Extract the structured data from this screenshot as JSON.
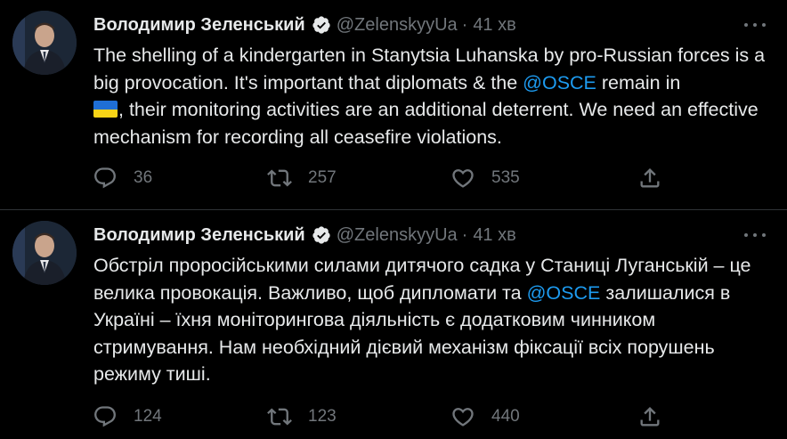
{
  "tweets": [
    {
      "author_name": "Володимир Зеленський",
      "handle": "@ZelenskyyUa",
      "separator": "·",
      "time": "41 хв",
      "text_1": "The shelling of a kindergarten in Stanytsia Luhanska by pro-Russian forces is a big provocation. It's important that diplomats & the ",
      "mention": "@OSCE",
      "text_2": " remain in ",
      "flag_icon": "ukraine-flag-emoji",
      "text_3": ", their monitoring activities are an additional deterrent. We need an effective mechanism for recording all ceasefire violations.",
      "replies": "36",
      "retweets": "257",
      "likes": "535"
    },
    {
      "author_name": "Володимир Зеленський",
      "handle": "@ZelenskyyUa",
      "separator": "·",
      "time": "41 хв",
      "text_1": "Обстріл проросійськими силами дитячого садка у Станиці Луганській – це велика провокація. Важливо, щоб дипломати та ",
      "mention": "@OSCE",
      "text_2": " залишалися в Україні – їхня моніторингова діяльність є додатковим чинником стримування. Нам необхідний дієвий механізм фіксації всіх порушень режиму тиші.",
      "replies": "124",
      "retweets": "123",
      "likes": "440"
    }
  ],
  "colors": {
    "background": "#000000",
    "text": "#e7e9ea",
    "secondary": "#71767b",
    "accent": "#1d9bf0",
    "divider": "#2f3336"
  },
  "icons": [
    "avatar",
    "verified-badge-icon",
    "more-icon",
    "reply-icon",
    "retweet-icon",
    "like-icon",
    "share-icon"
  ]
}
